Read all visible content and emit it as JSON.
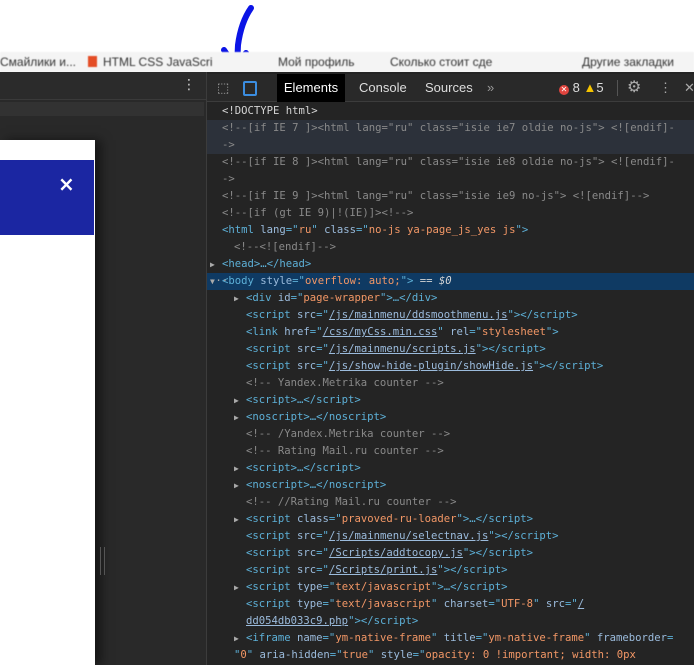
{
  "bookmarks": [
    {
      "label": "Смайлики и..."
    },
    {
      "label": "HTML CSS JavaScri",
      "favicon_color": "#e44d26"
    },
    {
      "label": "Мой профиль"
    },
    {
      "label": "Сколько стоит сде"
    },
    {
      "label": "Другие закладки"
    }
  ],
  "left_panel": {
    "menu_icon": "⋮",
    "banner_color": "#1b26a2",
    "close_label": "×"
  },
  "devtools": {
    "tabs": [
      {
        "label": "Elements",
        "active": true
      },
      {
        "label": "Console"
      },
      {
        "label": "Sources"
      }
    ],
    "more_tabs": "»",
    "errors": "8",
    "warnings": "5",
    "lines": [
      {
        "segs": [
          [
            "p",
            "<!DOCTYPE html>"
          ]
        ],
        "indent": 1
      },
      {
        "segs": [
          [
            "c",
            "<!--[if IE 7 ]><html lang=\"ru\" class=\"isie ie7 oldie no-js\"> <![endif]-"
          ]
        ],
        "indent": 1,
        "cls": "hover"
      },
      {
        "segs": [
          [
            "c",
            "->"
          ]
        ],
        "indent": 1,
        "cls": "hover"
      },
      {
        "segs": [
          [
            "c",
            "<!--[if IE 8 ]><html lang=\"ru\" class=\"isie ie8 oldie no-js\"> <![endif]-"
          ]
        ],
        "indent": 1
      },
      {
        "segs": [
          [
            "c",
            "->"
          ]
        ],
        "indent": 1
      },
      {
        "segs": [
          [
            "c",
            "<!--[if IE 9 ]><html lang=\"ru\" class=\"isie ie9 no-js\"> <![endif]-->"
          ]
        ],
        "indent": 1
      },
      {
        "segs": [
          [
            "c",
            "<!--[if (gt IE 9)|!(IE)]><!-->"
          ]
        ],
        "indent": 1
      },
      {
        "segs": [
          [
            "t",
            "<html "
          ],
          [
            "a",
            "lang"
          ],
          [
            "t",
            "=\""
          ],
          [
            "v",
            "ru"
          ],
          [
            "t",
            "\" "
          ],
          [
            "a",
            "class"
          ],
          [
            "t",
            "=\""
          ],
          [
            "v",
            "no-js ya-page_js_yes js"
          ],
          [
            "t",
            "\">"
          ]
        ],
        "indent": 1
      },
      {
        "segs": [
          [
            "c",
            "<!--<![endif]-->"
          ]
        ],
        "indent": 2
      },
      {
        "segs": [
          [
            "t",
            "<head>…</head>"
          ]
        ],
        "indent": 1,
        "tri": "▶"
      },
      {
        "segs": [
          [
            "t",
            "<body "
          ],
          [
            "a",
            "style"
          ],
          [
            "t",
            "=\""
          ],
          [
            "v",
            "overflow: auto;"
          ],
          [
            "t",
            "\">"
          ],
          [
            "p",
            " == "
          ],
          [
            "s",
            "$0"
          ]
        ],
        "indent": 1,
        "tri": "▼",
        "cls": "sel",
        "dots": "···"
      },
      {
        "segs": [
          [
            "t",
            "<div "
          ],
          [
            "a",
            "id"
          ],
          [
            "t",
            "=\""
          ],
          [
            "v",
            "page-wrapper"
          ],
          [
            "t",
            "\">…</div>"
          ]
        ],
        "indent": 3,
        "tri": "▶"
      },
      {
        "segs": [
          [
            "t",
            "<script "
          ],
          [
            "a",
            "src"
          ],
          [
            "t",
            "=\""
          ],
          [
            "u",
            "/js/mainmenu/ddsmoothmenu.js"
          ],
          [
            "t",
            "\"></script>"
          ]
        ],
        "indent": 3
      },
      {
        "segs": [
          [
            "t",
            "<link "
          ],
          [
            "a",
            "href"
          ],
          [
            "t",
            "=\""
          ],
          [
            "u",
            "/css/myCss.min.css"
          ],
          [
            "t",
            "\" "
          ],
          [
            "a",
            "rel"
          ],
          [
            "t",
            "=\""
          ],
          [
            "v",
            "stylesheet"
          ],
          [
            "t",
            "\">"
          ]
        ],
        "indent": 3
      },
      {
        "segs": [
          [
            "t",
            "<script "
          ],
          [
            "a",
            "src"
          ],
          [
            "t",
            "=\""
          ],
          [
            "u",
            "/js/mainmenu/scripts.js"
          ],
          [
            "t",
            "\"></script>"
          ]
        ],
        "indent": 3
      },
      {
        "segs": [
          [
            "t",
            "<script "
          ],
          [
            "a",
            "src"
          ],
          [
            "t",
            "=\""
          ],
          [
            "u",
            "/js/show-hide-plugin/showHide.js"
          ],
          [
            "t",
            "\"></script>"
          ]
        ],
        "indent": 3
      },
      {
        "segs": [
          [
            "c",
            "<!-- Yandex.Metrika counter -->"
          ]
        ],
        "indent": 3
      },
      {
        "segs": [
          [
            "t",
            "<script>…</script>"
          ]
        ],
        "indent": 3,
        "tri": "▶"
      },
      {
        "segs": [
          [
            "t",
            "<noscript>…</noscript>"
          ]
        ],
        "indent": 3,
        "tri": "▶"
      },
      {
        "segs": [
          [
            "c",
            "<!-- /Yandex.Metrika counter -->"
          ]
        ],
        "indent": 3
      },
      {
        "segs": [
          [
            "c",
            "<!-- Rating Mail.ru counter -->"
          ]
        ],
        "indent": 3
      },
      {
        "segs": [
          [
            "t",
            "<script>…</script>"
          ]
        ],
        "indent": 3,
        "tri": "▶"
      },
      {
        "segs": [
          [
            "t",
            "<noscript>…</noscript>"
          ]
        ],
        "indent": 3,
        "tri": "▶"
      },
      {
        "segs": [
          [
            "c",
            "<!-- //Rating Mail.ru counter -->"
          ]
        ],
        "indent": 3
      },
      {
        "segs": [
          [
            "t",
            "<script "
          ],
          [
            "a",
            "class"
          ],
          [
            "t",
            "=\""
          ],
          [
            "v",
            "pravoved-ru-loader"
          ],
          [
            "t",
            "\">…</script>"
          ]
        ],
        "indent": 3,
        "tri": "▶"
      },
      {
        "segs": [
          [
            "t",
            "<script "
          ],
          [
            "a",
            "src"
          ],
          [
            "t",
            "=\""
          ],
          [
            "u",
            "/js/mainmenu/selectnav.js"
          ],
          [
            "t",
            "\"></script>"
          ]
        ],
        "indent": 3
      },
      {
        "segs": [
          [
            "t",
            "<script "
          ],
          [
            "a",
            "src"
          ],
          [
            "t",
            "=\""
          ],
          [
            "u",
            "/Scripts/addtocopy.js"
          ],
          [
            "t",
            "\"></script>"
          ]
        ],
        "indent": 3
      },
      {
        "segs": [
          [
            "t",
            "<script "
          ],
          [
            "a",
            "src"
          ],
          [
            "t",
            "=\""
          ],
          [
            "u",
            "/Scripts/print.js"
          ],
          [
            "t",
            "\"></script>"
          ]
        ],
        "indent": 3
      },
      {
        "segs": [
          [
            "t",
            "<script "
          ],
          [
            "a",
            "type"
          ],
          [
            "t",
            "=\""
          ],
          [
            "v",
            "text/javascript"
          ],
          [
            "t",
            "\">…</script>"
          ]
        ],
        "indent": 3,
        "tri": "▶"
      },
      {
        "segs": [
          [
            "t",
            "<script "
          ],
          [
            "a",
            "type"
          ],
          [
            "t",
            "=\""
          ],
          [
            "v",
            "text/javascript"
          ],
          [
            "t",
            "\" "
          ],
          [
            "a",
            "charset"
          ],
          [
            "t",
            "=\""
          ],
          [
            "v",
            "UTF-8"
          ],
          [
            "t",
            "\" "
          ],
          [
            "a",
            "src"
          ],
          [
            "t",
            "=\""
          ],
          [
            "u",
            "/"
          ]
        ],
        "indent": 3
      },
      {
        "segs": [
          [
            "u",
            "dd054db033c9.php"
          ],
          [
            "t",
            "\"></script>"
          ]
        ],
        "indent": 3
      },
      {
        "segs": [
          [
            "t",
            "<iframe "
          ],
          [
            "a",
            "name"
          ],
          [
            "t",
            "=\""
          ],
          [
            "v",
            "ym-native-frame"
          ],
          [
            "t",
            "\" "
          ],
          [
            "a",
            "title"
          ],
          [
            "t",
            "=\""
          ],
          [
            "v",
            "ym-native-frame"
          ],
          [
            "t",
            "\" "
          ],
          [
            "a",
            "frameborder"
          ],
          [
            "t",
            "="
          ]
        ],
        "indent": 3,
        "tri": "▶"
      },
      {
        "segs": [
          [
            "t",
            "\""
          ],
          [
            "v",
            "0"
          ],
          [
            "t",
            "\" "
          ],
          [
            "a",
            "aria-hidden"
          ],
          [
            "t",
            "=\""
          ],
          [
            "v",
            "true"
          ],
          [
            "t",
            "\" "
          ],
          [
            "a",
            "style"
          ],
          [
            "t",
            "=\""
          ],
          [
            "v",
            "opacity: 0 !important; width: 0px"
          ]
        ],
        "indent": 2
      }
    ]
  }
}
